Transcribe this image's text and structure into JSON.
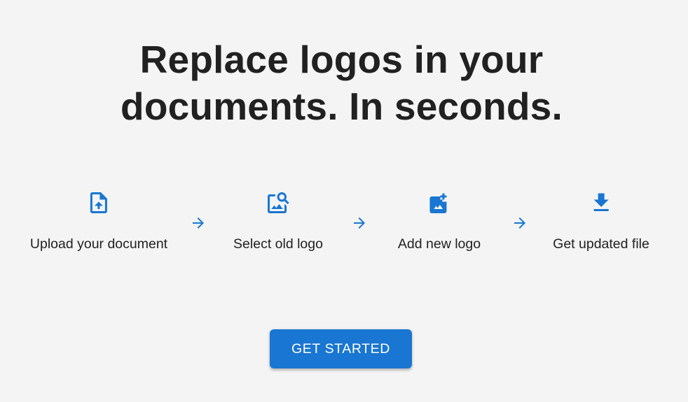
{
  "hero": {
    "title_line1": "Replace logos in your",
    "title_line2": "documents. In seconds."
  },
  "steps": [
    {
      "icon": "upload-file-icon",
      "label": "Upload your document"
    },
    {
      "icon": "image-search-icon",
      "label": "Select old logo"
    },
    {
      "icon": "add-photo-icon",
      "label": "Add new logo"
    },
    {
      "icon": "download-icon",
      "label": "Get updated file"
    }
  ],
  "step_arrow_icon": "arrow-forward-icon",
  "cta": {
    "label": "GET STARTED"
  },
  "colors": {
    "accent": "#1976d2",
    "background": "#f4f4f4",
    "text": "#212121"
  }
}
